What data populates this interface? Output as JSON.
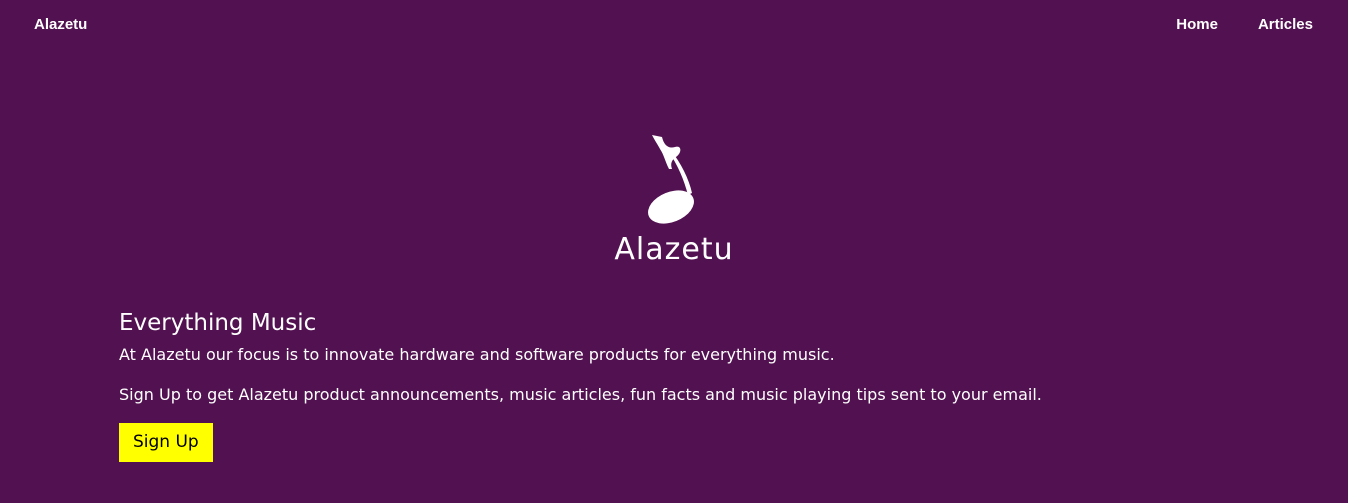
{
  "nav": {
    "brand": "Alazetu",
    "links": [
      {
        "label": "Home"
      },
      {
        "label": "Articles"
      }
    ]
  },
  "hero": {
    "logo_text": "Alazetu",
    "logo_icon": "music-note-icon"
  },
  "main": {
    "headline": "Everything Music",
    "paragraph_1": "At Alazetu our focus is to innovate hardware and software products for everything music.",
    "paragraph_2": "Sign Up to get Alazetu product announcements, music articles, fun facts and music playing tips sent to your email.",
    "signup_label": "Sign Up"
  },
  "colors": {
    "background": "#521150",
    "text": "#ffffff",
    "button_bg": "#ffff00",
    "button_text": "#000000"
  }
}
